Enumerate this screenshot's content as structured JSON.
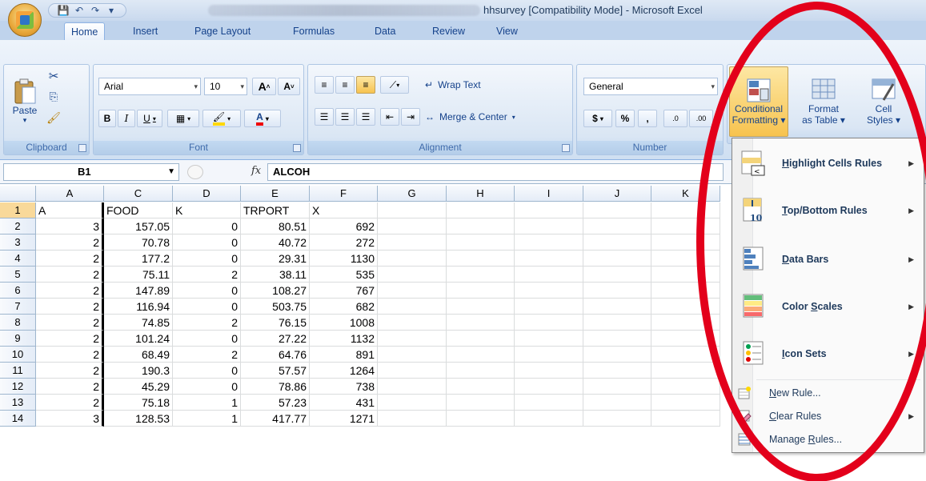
{
  "window": {
    "title": "hhsurvey  [Compatibility Mode] - Microsoft Excel"
  },
  "tabs": [
    "Home",
    "Insert",
    "Page Layout",
    "Formulas",
    "Data",
    "Review",
    "View"
  ],
  "ribbon": {
    "clipboard": {
      "label": "Clipboard",
      "paste": "Paste"
    },
    "font": {
      "label": "Font",
      "name": "Arial",
      "size": "10",
      "bold": "B",
      "italic": "I",
      "underline": "U",
      "grow": "A",
      "shrink": "A",
      "font_color": "A"
    },
    "alignment": {
      "label": "Alignment",
      "wrap_text": "Wrap Text",
      "merge_center": "Merge & Center"
    },
    "number": {
      "label": "Number",
      "format": "General",
      "currency": "$",
      "percent": "%",
      "comma": ",",
      "inc_decimal": ".0",
      "dec_decimal": ".00"
    },
    "styles": {
      "conditional_formatting_line1": "Conditional",
      "conditional_formatting_line2": "Formatting",
      "format_table_line1": "Format",
      "format_table_line2": "as Table",
      "cell_styles_line1": "Cell",
      "cell_styles_line2": "Styles"
    }
  },
  "formula_bar": {
    "name_box": "B1",
    "fx": "fx",
    "content": "ALCOH"
  },
  "grid": {
    "columns": [
      "A",
      "C",
      "D",
      "E",
      "F",
      "G",
      "H",
      "I",
      "J",
      "K"
    ],
    "rows": [
      {
        "n": "1",
        "cells": [
          "A",
          "FOOD",
          "K",
          "TRPORT",
          "X"
        ]
      },
      {
        "n": "2",
        "cells": [
          "3",
          "157.05",
          "0",
          "80.51",
          "692"
        ]
      },
      {
        "n": "3",
        "cells": [
          "2",
          "70.78",
          "0",
          "40.72",
          "272"
        ]
      },
      {
        "n": "4",
        "cells": [
          "2",
          "177.2",
          "0",
          "29.31",
          "1130"
        ]
      },
      {
        "n": "5",
        "cells": [
          "2",
          "75.11",
          "2",
          "38.11",
          "535"
        ]
      },
      {
        "n": "6",
        "cells": [
          "2",
          "147.89",
          "0",
          "108.27",
          "767"
        ]
      },
      {
        "n": "7",
        "cells": [
          "2",
          "116.94",
          "0",
          "503.75",
          "682"
        ]
      },
      {
        "n": "8",
        "cells": [
          "2",
          "74.85",
          "2",
          "76.15",
          "1008"
        ]
      },
      {
        "n": "9",
        "cells": [
          "2",
          "101.24",
          "0",
          "27.22",
          "1132"
        ]
      },
      {
        "n": "10",
        "cells": [
          "2",
          "68.49",
          "2",
          "64.76",
          "891"
        ]
      },
      {
        "n": "11",
        "cells": [
          "2",
          "190.3",
          "0",
          "57.57",
          "1264"
        ]
      },
      {
        "n": "12",
        "cells": [
          "2",
          "45.29",
          "0",
          "78.86",
          "738"
        ]
      },
      {
        "n": "13",
        "cells": [
          "2",
          "75.18",
          "1",
          "57.23",
          "431"
        ]
      },
      {
        "n": "14",
        "cells": [
          "3",
          "128.53",
          "1",
          "417.77",
          "1271"
        ]
      }
    ]
  },
  "menu": {
    "items": [
      {
        "label": "Highlight Cells Rules",
        "key": "H",
        "icon": "highlight-cells-icon"
      },
      {
        "label": "Top/Bottom Rules",
        "key": "T",
        "icon": "top-bottom-icon"
      },
      {
        "label": "Data Bars",
        "key": "D",
        "icon": "data-bars-icon"
      },
      {
        "label": "Color Scales",
        "key": "S",
        "icon": "color-scales-icon"
      },
      {
        "label": "Icon Sets",
        "key": "I",
        "icon": "icon-sets-icon"
      },
      {
        "label": "New Rule...",
        "key": "N",
        "icon": "new-rule-icon"
      },
      {
        "label": "Clear Rules",
        "key": "C",
        "icon": "clear-rules-icon"
      },
      {
        "label": "Manage Rules...",
        "key": "R",
        "icon": "manage-rules-icon"
      }
    ]
  },
  "colors": {
    "annotation": "#e3001b",
    "ribbon_text": "#15428b",
    "active_row_header": "#f9d99a"
  }
}
